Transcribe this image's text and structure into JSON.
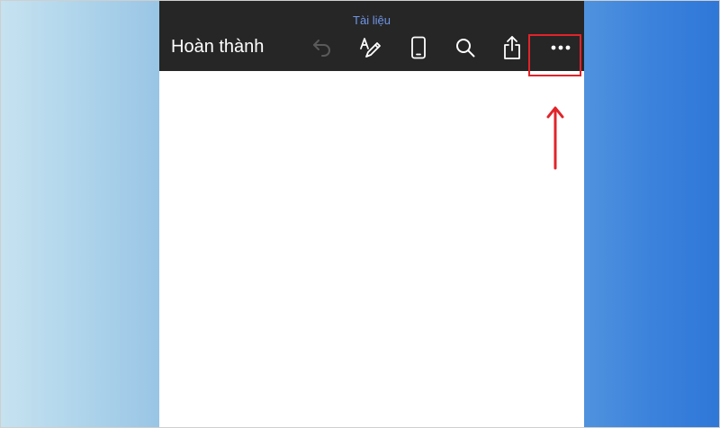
{
  "document": {
    "title": "Tài liệu"
  },
  "toolbar": {
    "done_label": "Hoàn thành",
    "icons": [
      "undo-icon",
      "pen-icon",
      "mobile-view-icon",
      "search-icon",
      "share-icon",
      "more-icon"
    ]
  },
  "colors": {
    "toolbar_background": "#262626",
    "title_text": "#6f95e6",
    "highlight": "#e0242a",
    "background_left": "#b1d6ec",
    "background_right": "#3b82dc"
  }
}
